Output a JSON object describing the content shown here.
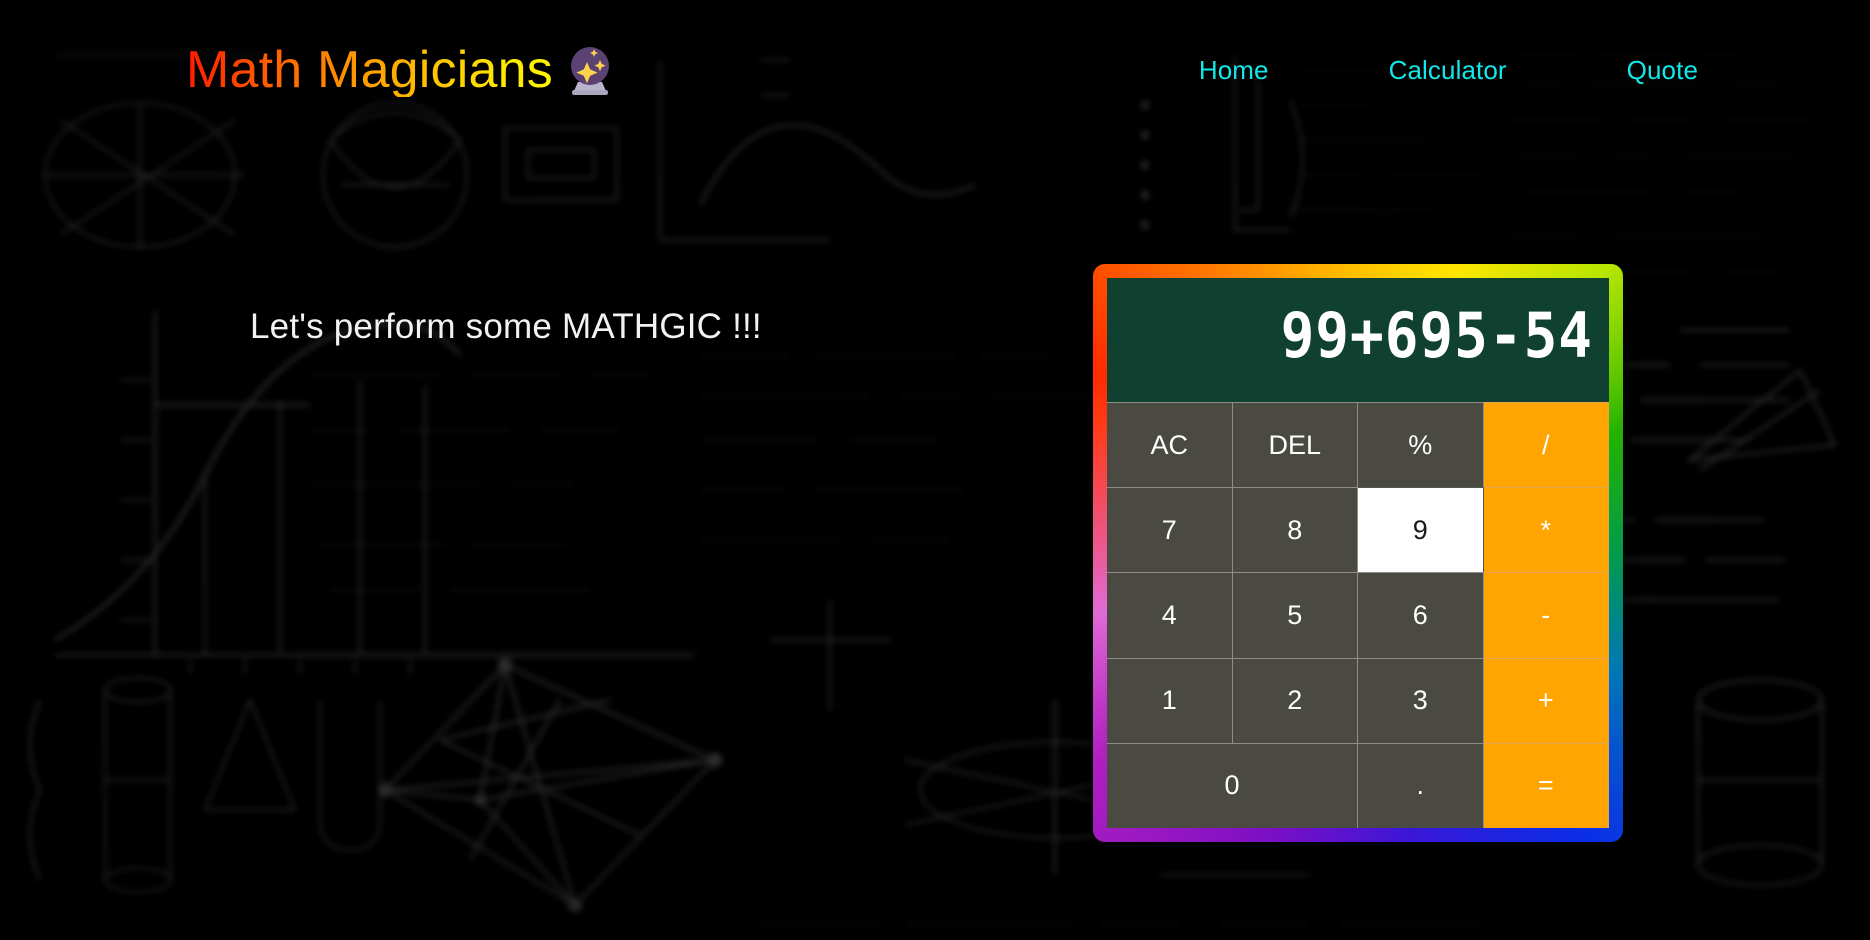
{
  "header": {
    "brand_text": "Math Magicians",
    "brand_icon": "crystal-ball-icon",
    "brand_gradient_from": "#ff1a00",
    "brand_gradient_to": "#fff600",
    "nav": [
      {
        "label": "Home",
        "name": "nav-link-home"
      },
      {
        "label": "Calculator",
        "name": "nav-link-calculator"
      },
      {
        "label": "Quote",
        "name": "nav-link-quote"
      }
    ],
    "nav_color": "#13e7e7"
  },
  "hero": {
    "tagline": "Let's perform some MATHGIC !!!",
    "tagline_color": "#f2f2f2"
  },
  "calculator": {
    "display_value": "99+695-54",
    "display_bg": "#10402f",
    "display_text_color": "#ffffff",
    "border_style": "rainbow-gradient",
    "key_bg": "#4a4a42",
    "operator_bg": "#ffa400",
    "active_key_bg": "#ffffff",
    "rows": [
      [
        {
          "label": "AC",
          "name": "key-all-clear",
          "type": "function"
        },
        {
          "label": "DEL",
          "name": "key-delete",
          "type": "function"
        },
        {
          "label": "%",
          "name": "key-percent",
          "type": "function"
        },
        {
          "label": "/",
          "name": "key-divide",
          "type": "operator"
        }
      ],
      [
        {
          "label": "7",
          "name": "key-7",
          "type": "digit"
        },
        {
          "label": "8",
          "name": "key-8",
          "type": "digit"
        },
        {
          "label": "9",
          "name": "key-9",
          "type": "digit",
          "state": "active"
        },
        {
          "label": "*",
          "name": "key-multiply",
          "type": "operator"
        }
      ],
      [
        {
          "label": "4",
          "name": "key-4",
          "type": "digit"
        },
        {
          "label": "5",
          "name": "key-5",
          "type": "digit"
        },
        {
          "label": "6",
          "name": "key-6",
          "type": "digit"
        },
        {
          "label": "-",
          "name": "key-subtract",
          "type": "operator"
        }
      ],
      [
        {
          "label": "1",
          "name": "key-1",
          "type": "digit"
        },
        {
          "label": "2",
          "name": "key-2",
          "type": "digit"
        },
        {
          "label": "3",
          "name": "key-3",
          "type": "digit"
        },
        {
          "label": "+",
          "name": "key-add",
          "type": "operator"
        }
      ],
      [
        {
          "label": "0",
          "name": "key-0",
          "type": "digit",
          "span": 2
        },
        {
          "label": ".",
          "name": "key-decimal",
          "type": "digit"
        },
        {
          "label": "=",
          "name": "key-equals",
          "type": "operator"
        }
      ]
    ]
  },
  "background": {
    "description": "blurred chalkboard math formulas and geometric diagrams",
    "color": "#000000",
    "chalk_color": "#ffffff"
  }
}
